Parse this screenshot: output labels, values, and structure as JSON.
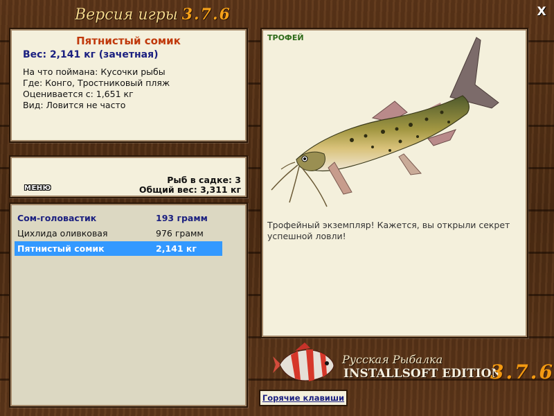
{
  "header": {
    "title": "Версия игры",
    "version": "3.7.6",
    "close_label": "X"
  },
  "catch_info": {
    "fish_name": "Пятнистый сомик",
    "weight": "Вес: 2,141 кг (зачетная)",
    "bait": "На что поймана: Кусочки рыбы",
    "location": "Где: Конго, Тростниковый пляж",
    "threshold": "Оценивается с: 1,651 кг",
    "frequency": "Вид: Ловится не часто"
  },
  "keepnet": {
    "menu_label": "МЕНЮ",
    "fish_count": "Рыб в садке: 3",
    "total_weight": "Общий вес: 3,311 кг"
  },
  "fish_list": [
    {
      "name": "Сом-головастик",
      "weight": "193 грамм",
      "style": "bold"
    },
    {
      "name": "Цихлида оливковая",
      "weight": "976 грамм",
      "style": "normal"
    },
    {
      "name": "Пятнистый сомик",
      "weight": "2,141 кг",
      "style": "selected"
    }
  ],
  "trophy": {
    "label": "ТРОФЕЙ",
    "message": "Трофейный экземпляр! Кажется, вы открыли секрет успешной ловли!"
  },
  "brand": {
    "line1": "Русская Рыбалка",
    "line2": "INSTALLSOFT EDITION",
    "version": "3.7.6"
  },
  "hotkeys_label": "Горячие клавиши",
  "colors": {
    "accent_orange": "#f39a12",
    "fish_name_red": "#c0390b",
    "link_blue": "#1b2080",
    "selection_blue": "#3399ff",
    "panel_bg": "#f4f0dc"
  }
}
